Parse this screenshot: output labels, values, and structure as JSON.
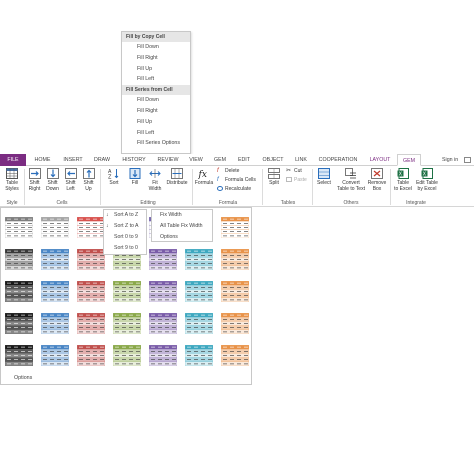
{
  "fill_menu": {
    "copy_header": "Fill by Copy Cell",
    "copy_items": [
      "Fill Down",
      "Fill Right",
      "Fill Up",
      "Fill Left"
    ],
    "series_header": "Fill Series from Cell",
    "series_items": [
      "Fill Down",
      "Fill Right",
      "Fill Up",
      "Fill Left",
      "Fill Series Options"
    ]
  },
  "tabs": [
    "FILE",
    "HOME",
    "INSERT",
    "DRAW",
    "HISTORY",
    "REVIEW",
    "VIEW",
    "GEM",
    "EDIT",
    "OBJECT",
    "LINK",
    "COOPERATION",
    "LAYOUT",
    "GEM"
  ],
  "active_tab_index": 13,
  "signin": "Sign in",
  "ribbon": {
    "table_styles_l1": "Table",
    "table_styles_l2": "Styles",
    "shift_right_l1": "Shift",
    "shift_right_l2": "Right",
    "shift_down_l1": "Shift",
    "shift_down_l2": "Down",
    "shift_left_l1": "Shift",
    "shift_left_l2": "Left",
    "shift_up_l1": "Shift",
    "shift_up_l2": "Up",
    "sort": "Sort",
    "fill": "Fill",
    "fit_l1": "Fit",
    "fit_l2": "Width",
    "distribute": "Distribute",
    "formula": "Formula",
    "delete": "Delete",
    "formula_cells": "Formula Cells",
    "recalculate": "Recalculate",
    "split": "Split",
    "cut": "Cut",
    "paste": "Paste",
    "select": "Select",
    "convert_l1": "Convert",
    "convert_l2": "Table to Text",
    "remove_l1": "Remove",
    "remove_l2": "Box",
    "table_excel_l1": "Table",
    "table_excel_l2": "to Excel",
    "edit_table_l1": "Edit Table",
    "edit_table_l2": "by Excel",
    "groups": [
      "Style",
      "Cells",
      "Editing",
      "Formula",
      "Tables",
      "Others",
      "Integrate"
    ]
  },
  "sort_menu": [
    "Sort A to Z",
    "Sort Z to A",
    "Sort 0 to 9",
    "Sort 9 to 0"
  ],
  "fit_menu": [
    "Fix Width",
    "All Table Fix Width",
    "Options"
  ],
  "gallery": {
    "options_label": "Options",
    "styles": [
      [
        "#7f7f7f",
        "#a5a5a5",
        "#d9534f",
        "#2f6f8f",
        "#7a6bb0",
        "#45a8c8",
        "#e8934a"
      ],
      [
        "#3a3a3a",
        "#4a86c5",
        "#c0504d",
        "#8aa84a",
        "#7a5ca8",
        "#3fa8c0",
        "#e8934a"
      ],
      [
        "#1a1a1a",
        "#4a86c5",
        "#c0504d",
        "#8aa84a",
        "#7a5ca8",
        "#3fa8c0",
        "#e8934a"
      ],
      [
        "#1a1a1a",
        "#4a86c5",
        "#c0504d",
        "#8aa84a",
        "#7a5ca8",
        "#3fa8c0",
        "#e8934a"
      ],
      [
        "#1a1a1a",
        "#4a86c5",
        "#c0504d",
        "#8aa84a",
        "#7a5ca8",
        "#3fa8c0",
        "#e8934a"
      ]
    ]
  }
}
